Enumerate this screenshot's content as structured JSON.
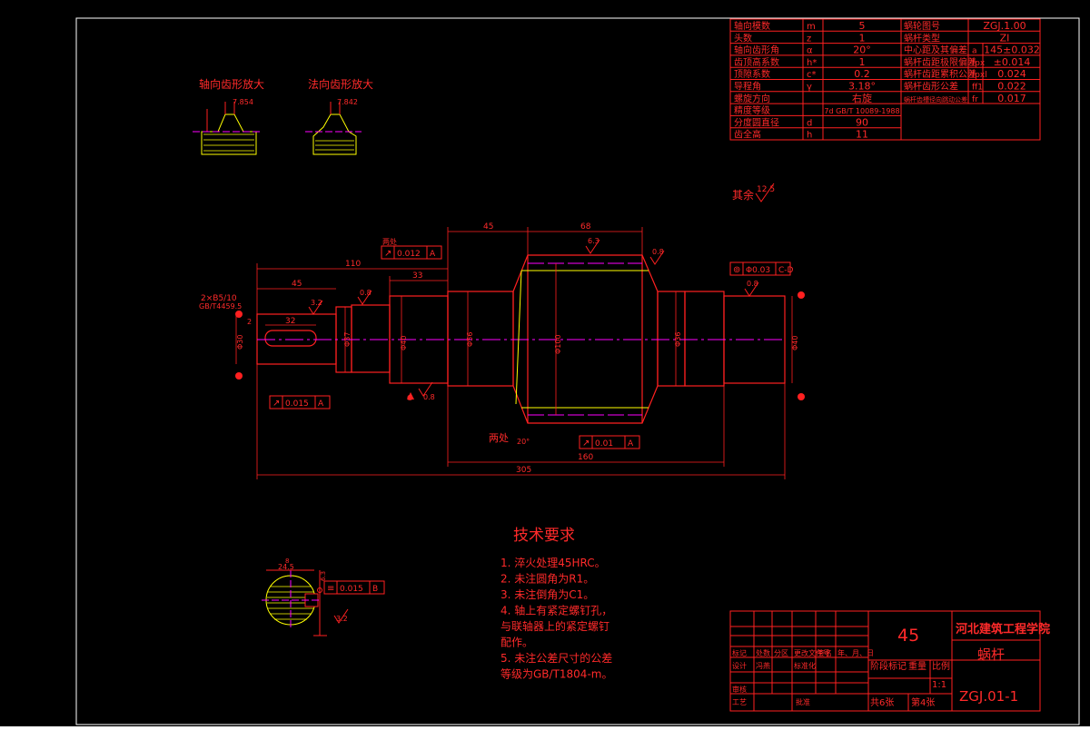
{
  "colors": {
    "background": "#000000",
    "border": "#ffffff",
    "line": "#ff2020",
    "centerline": "#ff00ff",
    "hatch": "#ffff00"
  },
  "detail_titles": {
    "axial": "轴向齿形放大",
    "normal": "法向齿形放大"
  },
  "detail_dims": {
    "axial": "7.854",
    "normal": "7.842"
  },
  "param_table": {
    "rows": [
      {
        "name": "轴向模数",
        "sym": "m",
        "val": "5"
      },
      {
        "name": "头数",
        "sym": "z",
        "val": "1"
      },
      {
        "name": "轴向齿形角",
        "sym": "α",
        "val": "20°"
      },
      {
        "name": "齿顶高系数",
        "sym": "h*",
        "val": "1"
      },
      {
        "name": "顶隙系数",
        "sym": "c*",
        "val": "0.2"
      },
      {
        "name": "导程角",
        "sym": "γ",
        "val": "3.18°"
      },
      {
        "name": "螺旋方向",
        "sym": "",
        "val": "右旋"
      },
      {
        "name": "精度等级",
        "sym": "",
        "val": "7d GB/T 10089-1988"
      },
      {
        "name": "分度圆直径",
        "sym": "d",
        "val": "90"
      },
      {
        "name": "齿全高",
        "sym": "h",
        "val": "11"
      }
    ],
    "right_rows": [
      {
        "name": "蜗轮图号",
        "sym": "",
        "val": "ZGJ.1.00"
      },
      {
        "name": "蜗杆类型",
        "sym": "",
        "val": "ZI"
      },
      {
        "name": "中心距及其偏差",
        "sym": "a",
        "val": "145±0.032"
      },
      {
        "name": "蜗杆齿距极限偏差",
        "sym": "fpx",
        "val": "±0.014"
      },
      {
        "name": "蜗杆齿距累积公差",
        "sym": "fpxl",
        "val": "0.024"
      },
      {
        "name": "蜗杆齿形公差",
        "sym": "ff1",
        "val": "0.022"
      },
      {
        "name": "蜗杆齿槽径向跳动公差",
        "sym": "fr",
        "val": "0.017"
      }
    ]
  },
  "surface_note": {
    "label": "其余",
    "value": "12.5"
  },
  "dims": {
    "d45": "45",
    "d68": "68",
    "d110": "110",
    "d33": "33",
    "d45b": "45",
    "d32": "32",
    "d160": "160",
    "d305": "305",
    "dia_a": "Φ30",
    "dia_b": "Φ37",
    "dia_c": "Φ40",
    "dia_d": "Φ56",
    "dia_e": "Φ100",
    "dia_f": "Φ36",
    "dia_g": "Φ40",
    "slot": "2×B5/10",
    "slot_std": "GB/T4459.5",
    "chamfer": "2",
    "angle": "20°",
    "twice": "两处",
    "twice2": "两处"
  },
  "roughness": {
    "r1": "3.2",
    "r2": "6.3",
    "r3": "0.8",
    "r4": "0.8",
    "r5": "0.8",
    "r6": "0.8",
    "r7": "3.2"
  },
  "tolerances": {
    "t1": {
      "sym": "↗",
      "val": "0.012",
      "ref": "A"
    },
    "t2": {
      "sym": "⊚",
      "val": "Φ0.03",
      "ref": "C-D"
    },
    "t3": {
      "sym": "↗",
      "val": "0.015",
      "ref": "A"
    },
    "t4": {
      "sym": "↗",
      "val": "0.01",
      "ref": "A"
    },
    "t5": {
      "sym": "≡",
      "val": "0.015",
      "ref": "B"
    }
  },
  "section": {
    "dim1": "24.5",
    "dim2": "8",
    "dim3": "6.3"
  },
  "tech": {
    "title": "技术要求",
    "items": [
      "1. 淬火处理45HRC。",
      "2. 未注圆角为R1。",
      "3. 未注倒角为C1。",
      "4. 轴上有紧定螺钉孔，",
      "与联轴器上的紧定螺钉",
      "配作。",
      "5. 未注公差尺寸的公差",
      "等级为GB/T1804-m。"
    ]
  },
  "title_block": {
    "material": "45",
    "school": "河北建筑工程学院",
    "part": "蜗杆",
    "drawing_no": "ZGJ.01-1",
    "scale": "1:1",
    "stage": "阶段标记",
    "weight": "重量",
    "ratio": "比例",
    "sheets": "共6张",
    "sheet": "第4张",
    "design": "设计",
    "check": "审核",
    "process": "工艺",
    "approve": "批准",
    "mark": "标记",
    "count": "处数",
    "zone": "分区",
    "change": "更改文件号",
    "sign": "签名",
    "date": "年、月、日",
    "designer": "冯燕",
    "std": "标准化"
  }
}
